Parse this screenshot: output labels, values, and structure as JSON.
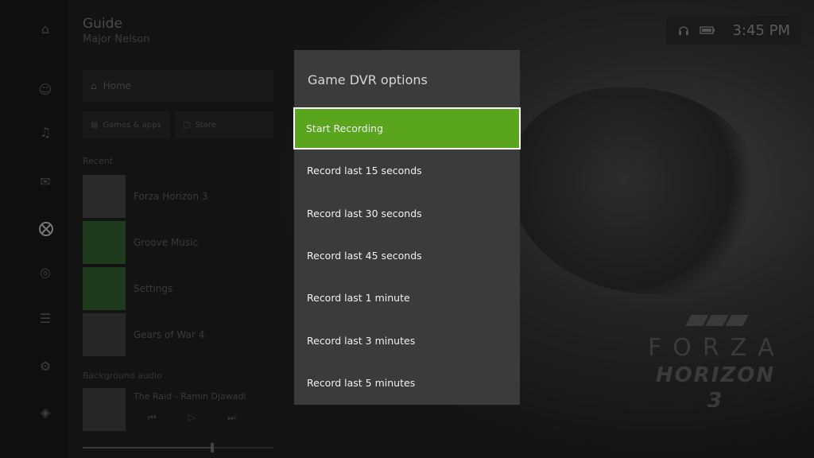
{
  "guide": {
    "title": "Guide",
    "username": "Major Nelson",
    "home_label": "Home",
    "games_apps_label": "Games & apps",
    "store_label": "Store",
    "recent_header": "Recent",
    "recent": [
      {
        "label": "Forza Horizon 3"
      },
      {
        "label": "Groove Music"
      },
      {
        "label": "Settings"
      },
      {
        "label": "Gears of War 4"
      }
    ],
    "now_playing_header": "Background audio",
    "now_playing_song": "The Raid - Ramin Djawadi",
    "playback_progress": 0.68
  },
  "status": {
    "time": "3:45 PM"
  },
  "dialog": {
    "title": "Game DVR options",
    "items": [
      {
        "label": "Start Recording",
        "selected": true
      },
      {
        "label": "Record last 15 seconds"
      },
      {
        "label": "Record last 30 seconds"
      },
      {
        "label": "Record last 45 seconds"
      },
      {
        "label": "Record last 1 minute"
      },
      {
        "label": "Record last 3 minutes"
      },
      {
        "label": "Record last 5 minutes"
      }
    ]
  },
  "background": {
    "game_logo_line1": "FORZA",
    "game_logo_line2": "HORIZON 3"
  },
  "colors": {
    "accent": "#5aa51e",
    "dialog_bg": "#3b3b3b"
  }
}
